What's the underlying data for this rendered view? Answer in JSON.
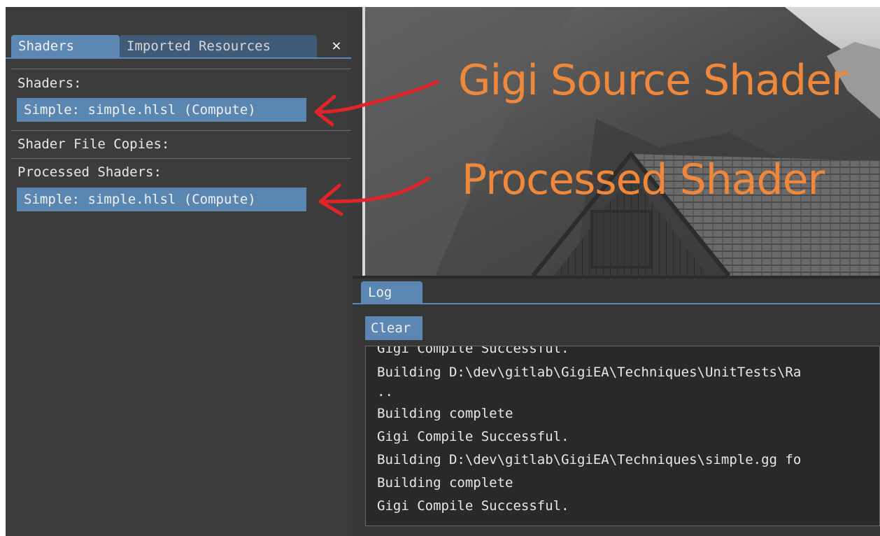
{
  "left_panel": {
    "tabs": [
      {
        "label": "Shaders",
        "active": true
      },
      {
        "label": "Imported Resources",
        "active": false
      }
    ],
    "close_icon": "close-icon",
    "sections": {
      "shaders_label": "Shaders:",
      "shaders_item": "Simple: simple.hlsl (Compute)",
      "file_copies_label": "Shader File Copies:",
      "processed_label": "Processed Shaders:",
      "processed_item": "Simple: simple.hlsl (Compute)"
    }
  },
  "annotations": {
    "source_label": "Gigi Source Shader",
    "processed_label": "Processed Shader",
    "color": "#f0883c",
    "arrow_color": "#e0242a"
  },
  "log": {
    "tab_label": "Log",
    "clear_label": "Clear",
    "lines": [
      "Gigi Compile Successful.",
      "Building D:\\dev\\gitlab\\GigiEA\\Techniques\\UnitTests\\Ra",
      "..",
      "Building complete",
      "Gigi Compile Successful.",
      "Building D:\\dev\\gitlab\\GigiEA\\Techniques\\simple.gg fo",
      "Building complete",
      "Gigi Compile Successful."
    ]
  },
  "colors": {
    "accent": "#5b87b2",
    "panel_bg": "#3c3c3c",
    "log_bg": "#292929"
  }
}
